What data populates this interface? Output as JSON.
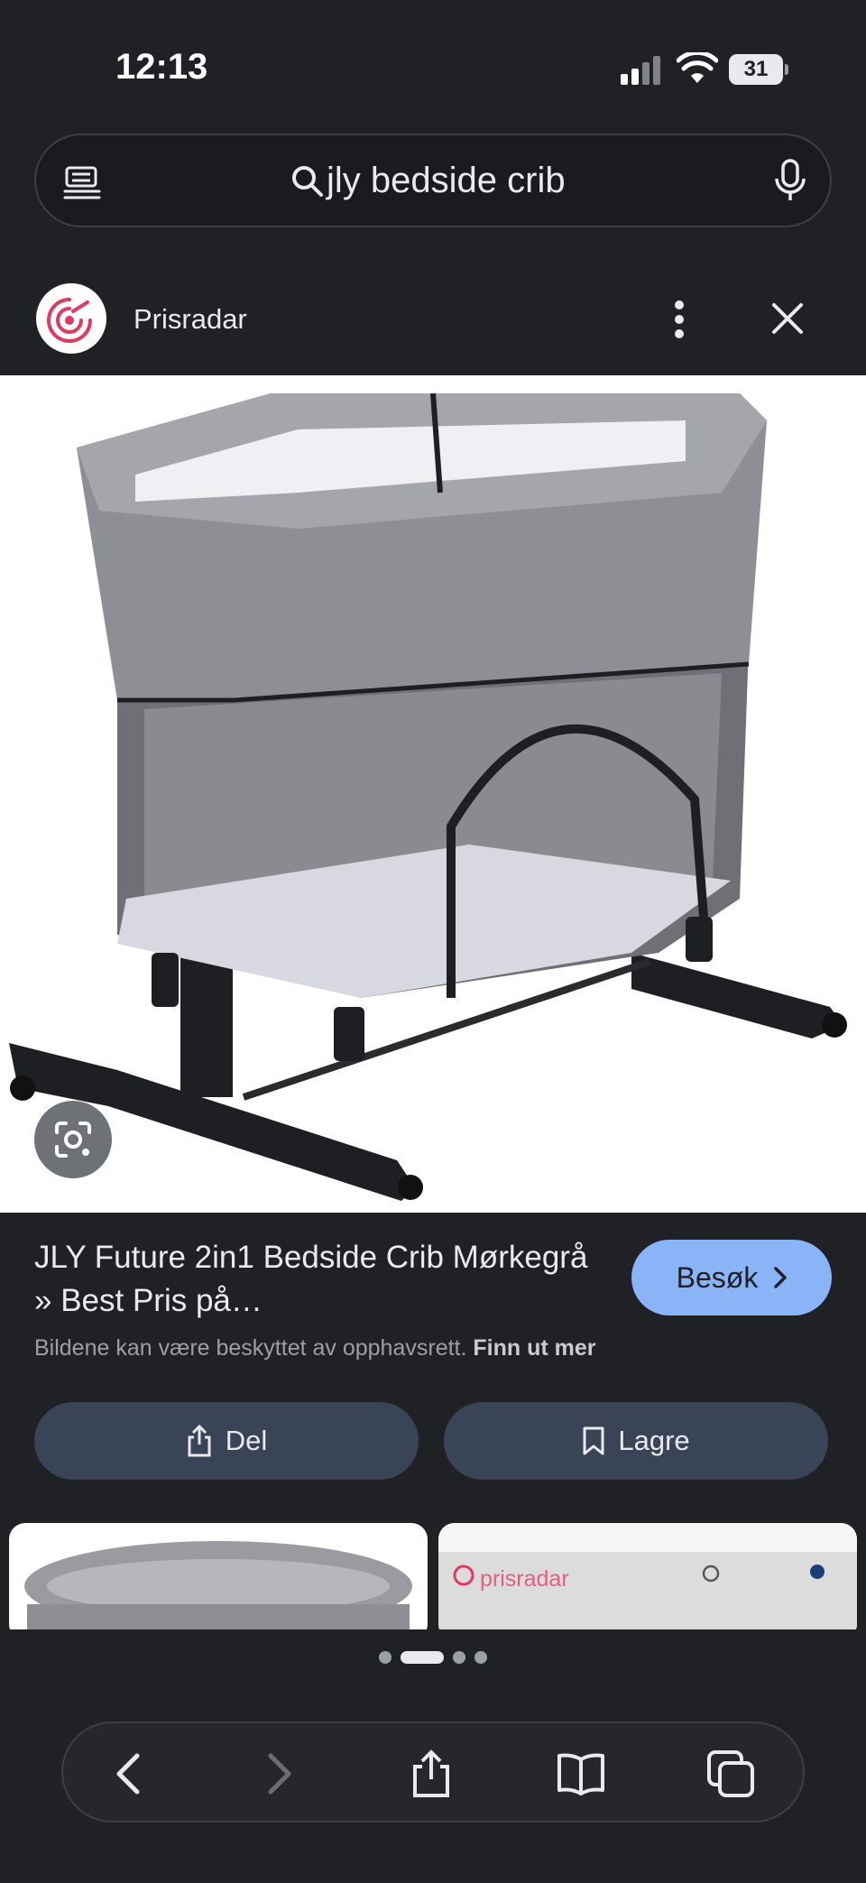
{
  "status_bar": {
    "time": "12:13",
    "battery": "31"
  },
  "search": {
    "query": "jly bedside crib"
  },
  "source": {
    "name": "Prisradar"
  },
  "result": {
    "title": "JLY Future 2in1 Bedside Crib Mørkegrå » Best Pris på…",
    "visit_label": "Besøk",
    "copyright_text": "Bildene kan være beskyttet av opphavsrett.",
    "learn_more": "Finn ut mer"
  },
  "actions": {
    "share_label": "Del",
    "save_label": "Lagre"
  },
  "related": {
    "thumb2_brand": "prisradar"
  },
  "colors": {
    "accent": "#8ab4f8",
    "background": "#202124",
    "button": "#394457"
  },
  "icons": [
    "menu-icon",
    "search-icon",
    "mic-icon",
    "more-vert-icon",
    "close-icon",
    "lens-icon",
    "chevron-right-icon",
    "share-icon",
    "bookmark-icon",
    "back-icon",
    "forward-icon",
    "share-sheet-icon",
    "bookmarks-icon",
    "tabs-icon"
  ]
}
